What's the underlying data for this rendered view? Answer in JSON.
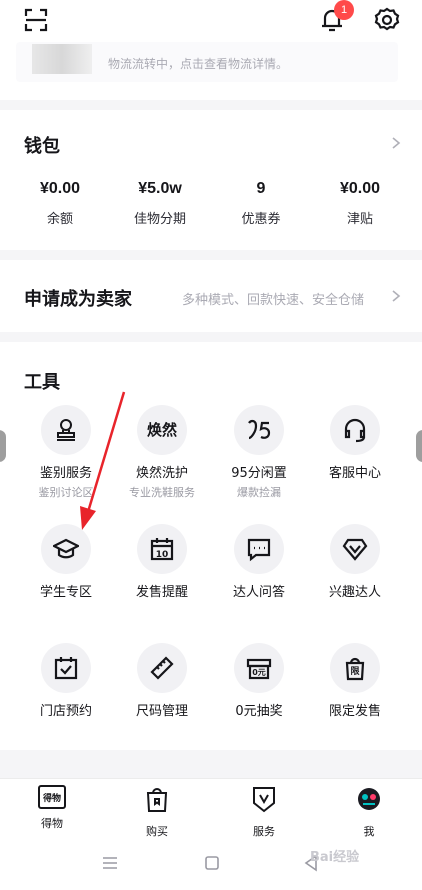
{
  "header": {
    "notification_count": "1",
    "logistics_text": "物流流转中，点击查看物流详情。"
  },
  "wallet": {
    "title": "钱包",
    "stats": [
      {
        "value": "¥0.00",
        "label": "余额"
      },
      {
        "value": "¥5.0w",
        "label": "佳物分期"
      },
      {
        "value": "9",
        "label": "优惠券"
      },
      {
        "value": "¥0.00",
        "label": "津贴"
      }
    ]
  },
  "seller": {
    "title": "申请成为卖家",
    "subtitle": "多种模式、回款快速、安全仓储"
  },
  "tools": {
    "title": "工具",
    "items": [
      {
        "label": "鉴别服务",
        "sub": "鉴别讨论区",
        "icon": "stamp-icon"
      },
      {
        "label": "焕然洗护",
        "sub": "专业洗鞋服务",
        "icon": "huanran-text-icon",
        "icon_text": "焕然"
      },
      {
        "label": "95分闲置",
        "sub": "爆款捡漏",
        "icon": "95-logo-icon"
      },
      {
        "label": "客服中心",
        "sub": "",
        "icon": "headset-icon"
      },
      {
        "label": "学生专区",
        "sub": "",
        "icon": "graduation-cap-icon"
      },
      {
        "label": "发售提醒",
        "sub": "",
        "icon": "calendar-icon",
        "icon_text": "10"
      },
      {
        "label": "达人问答",
        "sub": "",
        "icon": "chat-icon"
      },
      {
        "label": "兴趣达人",
        "sub": "",
        "icon": "diamond-icon"
      },
      {
        "label": "门店预约",
        "sub": "",
        "icon": "calendar-check-icon"
      },
      {
        "label": "尺码管理",
        "sub": "",
        "icon": "ruler-icon"
      },
      {
        "label": "0元抽奖",
        "sub": "",
        "icon": "lottery-icon",
        "icon_text": "0元"
      },
      {
        "label": "限定发售",
        "sub": "",
        "icon": "limited-bag-icon",
        "icon_text": "限"
      }
    ]
  },
  "tabbar": {
    "items": [
      {
        "label": "得物",
        "icon": "dewu-logo-icon",
        "icon_text": "得物"
      },
      {
        "label": "购买",
        "icon": "shopping-bag-icon"
      },
      {
        "label": "服务",
        "icon": "shield-v-icon"
      },
      {
        "label": "我",
        "icon": "avatar-icon"
      }
    ]
  },
  "watermark": "Bai经验",
  "colors": {
    "accent": "#01c2c3",
    "badge": "#ff4a4a",
    "annotation": "#e8242b"
  }
}
